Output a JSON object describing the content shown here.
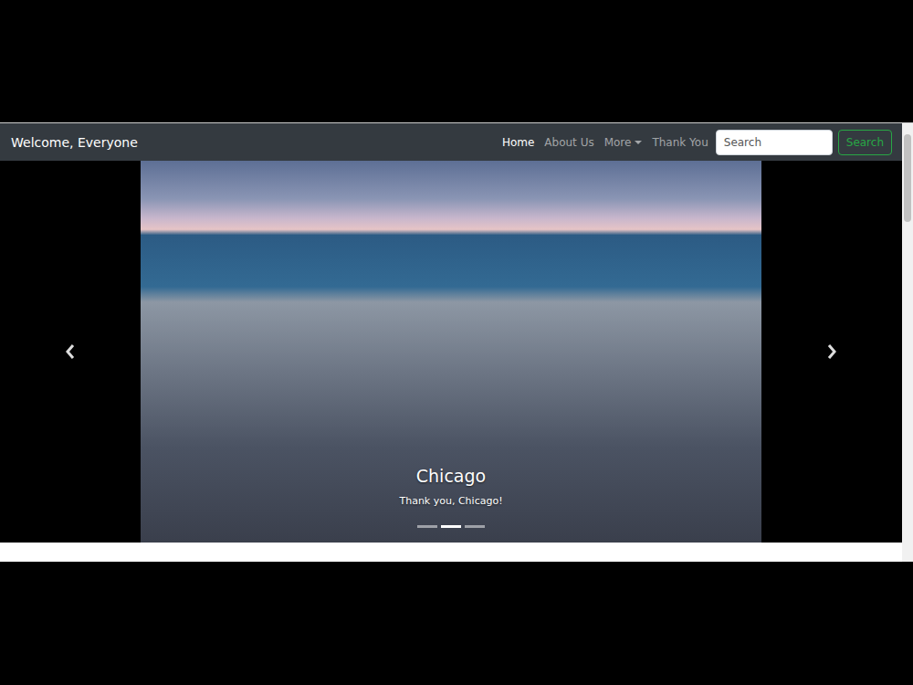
{
  "navbar": {
    "brand": "Welcome, Everyone",
    "items": [
      {
        "label": "Home",
        "selected": true,
        "kind": "link"
      },
      {
        "label": "About Us",
        "selected": false,
        "kind": "link"
      },
      {
        "label": "More",
        "selected": false,
        "kind": "dropdown"
      },
      {
        "label": "Thank You",
        "selected": false,
        "kind": "link"
      }
    ],
    "search": {
      "placeholder": "Search",
      "button": "Search"
    }
  },
  "carousel": {
    "caption": {
      "title": "Chicago",
      "text": "Thank you, Chicago!"
    },
    "indicators": [
      {
        "selected": false
      },
      {
        "selected": true
      },
      {
        "selected": false
      }
    ]
  }
}
